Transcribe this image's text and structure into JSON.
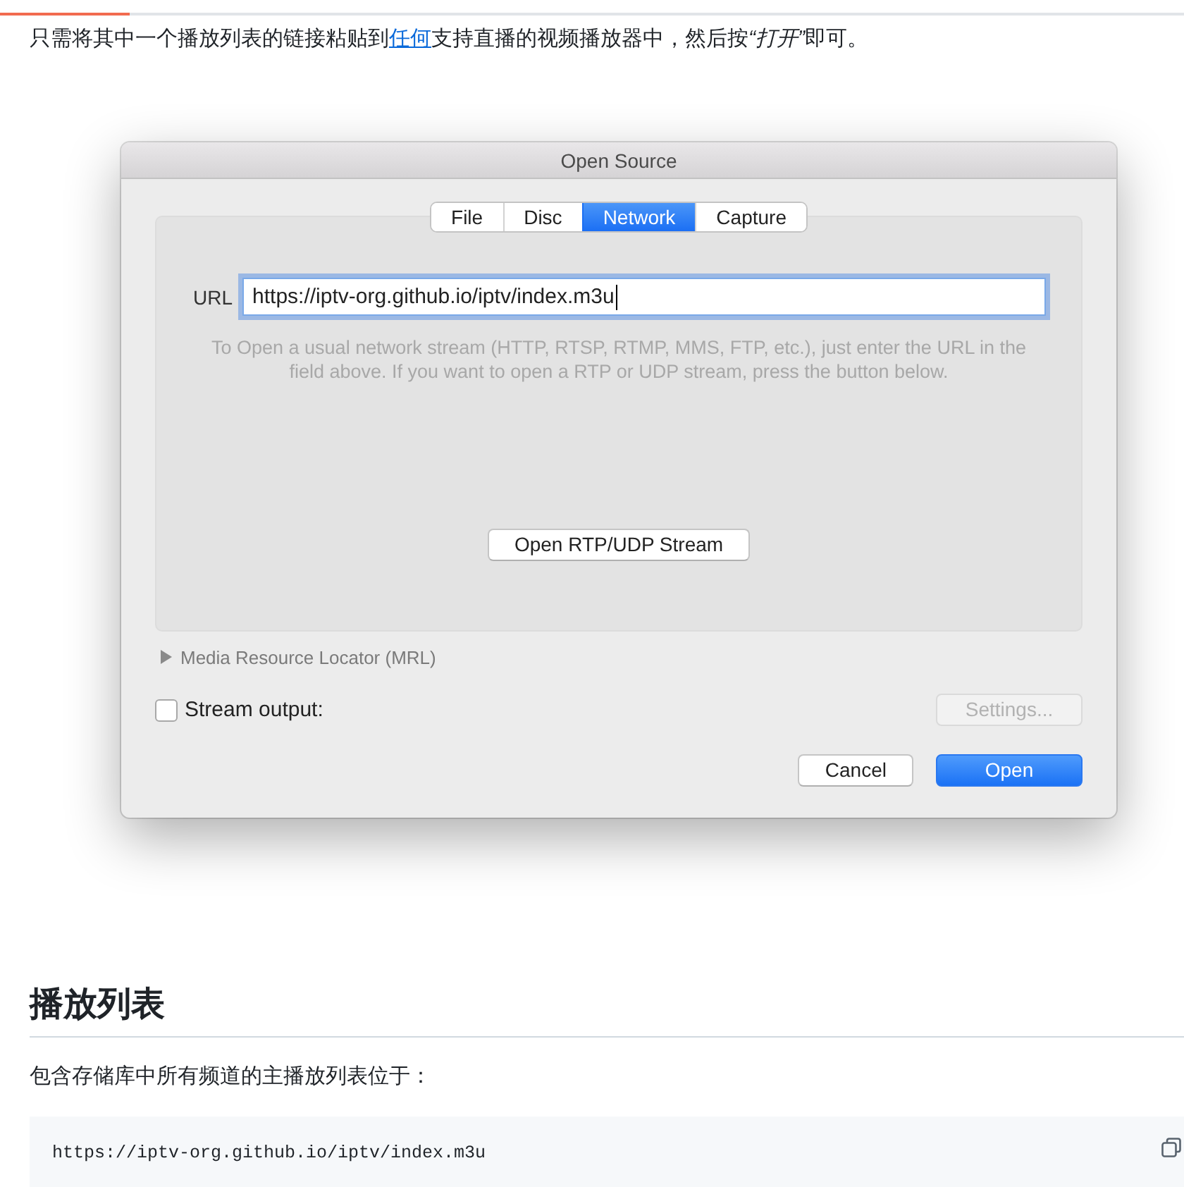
{
  "reading_progress": {
    "level": 0.11
  },
  "intro": {
    "before": "只需将其中一个播放列表的链接粘贴到",
    "link": "任何",
    "middle": "支持直播的视频播放器中，然后按",
    "emphasis": "“打开”",
    "after": "即可。"
  },
  "dialog": {
    "title": "Open Source",
    "tabs": [
      {
        "label": "File",
        "selected": false
      },
      {
        "label": "Disc",
        "selected": false
      },
      {
        "label": "Network",
        "selected": true
      },
      {
        "label": "Capture",
        "selected": false
      }
    ],
    "url": {
      "label": "URL",
      "value": "https://iptv-org.github.io/iptv/index.m3u",
      "focused": true
    },
    "help_text": "To Open a usual network stream (HTTP, RTSP, RTMP, MMS, FTP, etc.), just enter the URL in the field above. If you want to open a RTP or UDP stream, press the button below.",
    "rtp_button": "Open RTP/UDP Stream",
    "mrl": {
      "label": "Media Resource Locator (MRL)",
      "expanded": false
    },
    "stream_output": {
      "label": "Stream output:",
      "checked": false
    },
    "settings_button": {
      "label": "Settings...",
      "disabled": true
    },
    "buttons": [
      {
        "label": "Cancel",
        "kind": "secondary"
      },
      {
        "label": "Open",
        "kind": "primary"
      }
    ]
  },
  "playlist_section": {
    "heading": "播放列表",
    "text": "包含存储库中所有频道的主播放列表位于：",
    "code": "https://iptv-org.github.io/iptv/index.m3u"
  }
}
